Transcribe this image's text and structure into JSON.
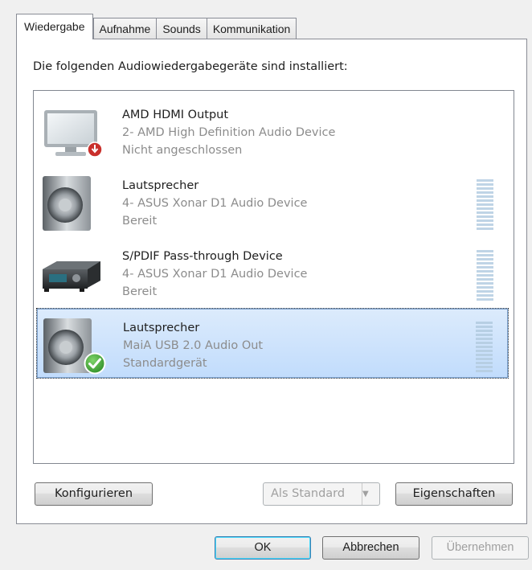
{
  "tabs": [
    {
      "label": "Wiedergabe",
      "active": true
    },
    {
      "label": "Aufnahme",
      "active": false
    },
    {
      "label": "Sounds",
      "active": false
    },
    {
      "label": "Kommunikation",
      "active": false
    }
  ],
  "instruction": "Die folgenden Audiowiedergabegeräte sind installiert:",
  "devices": [
    {
      "name": "AMD HDMI Output",
      "description": "2- AMD High Definition Audio Device",
      "status": "Nicht angeschlossen",
      "icon": "monitor-icon",
      "badge": "disconnected-badge-icon",
      "selected": false,
      "meter": false
    },
    {
      "name": "Lautsprecher",
      "description": "4- ASUS Xonar D1 Audio Device",
      "status": "Bereit",
      "icon": "speaker-icon",
      "badge": "",
      "selected": false,
      "meter": true
    },
    {
      "name": "S/PDIF Pass-through Device",
      "description": "4- ASUS Xonar D1 Audio Device",
      "status": "Bereit",
      "icon": "receiver-icon",
      "badge": "",
      "selected": false,
      "meter": true
    },
    {
      "name": "Lautsprecher",
      "description": "MaiA USB 2.0 Audio Out",
      "status": "Standardgerät",
      "icon": "speaker-icon",
      "badge": "default-checkmark-icon",
      "selected": true,
      "meter": true
    }
  ],
  "buttons": {
    "configure": "Konfigurieren",
    "set_default": "Als Standard",
    "properties": "Eigenschaften",
    "ok": "OK",
    "cancel": "Abbrechen",
    "apply": "Übernehmen"
  },
  "colors": {
    "selection": "#c1dcfc",
    "meter": "#bfd4e6",
    "disabled_text": "#a0a0a0"
  }
}
